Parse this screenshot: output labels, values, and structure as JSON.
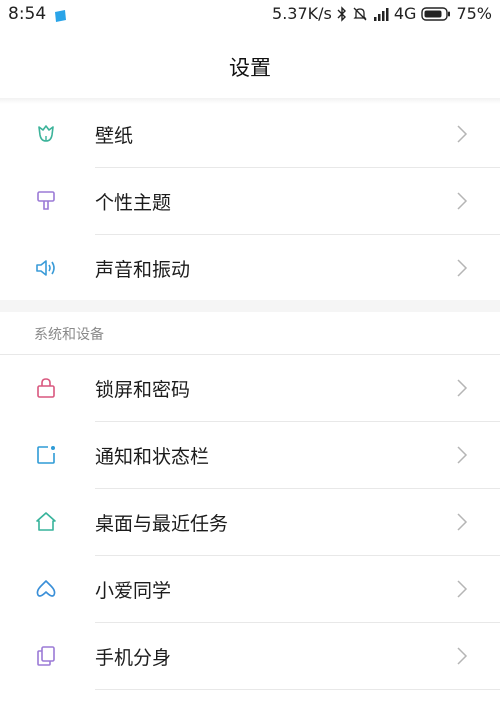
{
  "status_bar": {
    "time": "8:54",
    "net_speed": "5.37K/s",
    "network": "4G",
    "battery": "75%"
  },
  "header": {
    "title": "设置"
  },
  "group1": {
    "items": [
      {
        "label": "壁纸",
        "icon": "wallpaper-tulip-icon",
        "color": "#3cb39a"
      },
      {
        "label": "个性主题",
        "icon": "theme-brush-icon",
        "color": "#9b7ad6"
      },
      {
        "label": "声音和振动",
        "icon": "speaker-icon",
        "color": "#3a9bd8"
      }
    ]
  },
  "group2": {
    "section_title": "系统和设备",
    "items": [
      {
        "label": "锁屏和密码",
        "icon": "lock-icon",
        "color": "#d9577e"
      },
      {
        "label": "通知和状态栏",
        "icon": "notification-icon",
        "color": "#2f9bd6"
      },
      {
        "label": "桌面与最近任务",
        "icon": "home-icon",
        "color": "#37b39b"
      },
      {
        "label": "小爱同学",
        "icon": "xiaoai-assistant-icon",
        "color": "#3a8fd8"
      },
      {
        "label": "手机分身",
        "icon": "second-space-icon",
        "color": "#9b7ad6"
      }
    ]
  }
}
